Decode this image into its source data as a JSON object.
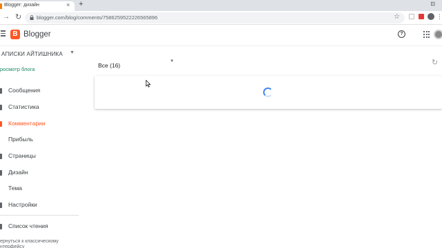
{
  "browser": {
    "tab_title": "Blogger: дизайн",
    "tab_close": "×",
    "new_tab": "+",
    "url": "blogger.com/blog/comments/7586259522226565896",
    "star": "☆",
    "minimize": "⊡"
  },
  "header": {
    "logo_letter": "B",
    "brand": "Blogger",
    "help": "?"
  },
  "sidebar": {
    "blog_name": "АПИСКИ АЙТИШНИКА",
    "view_blog": "росмотр блога",
    "items": [
      {
        "label": "Сообщения",
        "active": false
      },
      {
        "label": "Статистика",
        "active": false
      },
      {
        "label": "Комментарии",
        "active": true
      },
      {
        "label": "Прибыль",
        "active": false
      },
      {
        "label": "Страницы",
        "active": false
      },
      {
        "label": "Дизайн",
        "active": false
      },
      {
        "label": "Тема",
        "active": false
      },
      {
        "label": "Настройки",
        "active": false
      }
    ],
    "reading_list": "Список чтения",
    "classic_link": "ернуться к классическому нтерфейсу"
  },
  "main": {
    "filter_label": "Все (16)",
    "loading": true
  },
  "colors": {
    "accent": "#ff5722",
    "view_blog_link": "#1a8765",
    "spinner": "#4285f4"
  },
  "icons": [
    "hamburger-icon",
    "blogger-logo-icon",
    "help-icon",
    "apps-icon",
    "refresh-icon",
    "lock-icon",
    "star-icon",
    "loading-spinner-icon"
  ]
}
